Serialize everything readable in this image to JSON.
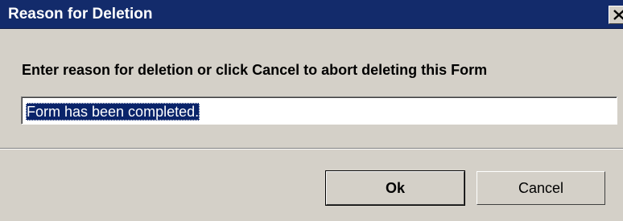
{
  "window": {
    "title": "Reason for Deletion",
    "close_icon": "close-x-icon"
  },
  "dialog": {
    "prompt": "Enter reason for deletion or click Cancel to abort deleting this Form",
    "reason_value": "Form has been completed."
  },
  "buttons": {
    "ok_label": "Ok",
    "cancel_label": "Cancel"
  },
  "colors": {
    "titlebar": "#132b6b",
    "dialog_bg": "#d4d0c8",
    "selection": "#0a246a"
  }
}
